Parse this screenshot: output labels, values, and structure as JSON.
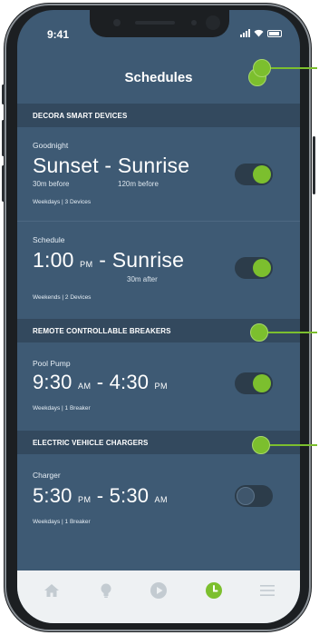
{
  "status_bar": {
    "time": "9:41"
  },
  "header": {
    "title": "Schedules"
  },
  "sections": [
    {
      "label": "DECORA SMART DEVICES"
    },
    {
      "label": "REMOTE CONTROLLABLE BREAKERS"
    },
    {
      "label": "ELECTRIC VEHICLE CHARGERS"
    }
  ],
  "schedules": [
    {
      "title": "Goodnight",
      "start": "Sunset",
      "start_ampm": "",
      "sep": " - ",
      "end": "Sunrise",
      "end_ampm": "",
      "start_offset": "30m before",
      "end_offset": "120m before",
      "meta": "Weekdays | 3 Devices",
      "enabled": true
    },
    {
      "title": "Schedule",
      "start": "1:00",
      "start_ampm": "PM",
      "sep": " - ",
      "end": "Sunrise",
      "end_ampm": "",
      "start_offset": "",
      "end_offset": "30m after",
      "meta": "Weekends | 2 Devices",
      "enabled": true
    },
    {
      "title": "Pool Pump",
      "start": "9:30",
      "start_ampm": "AM",
      "sep": " - ",
      "end": "4:30",
      "end_ampm": "PM",
      "start_offset": "",
      "end_offset": "",
      "meta": "Weekdays | 1 Breaker",
      "enabled": true
    },
    {
      "title": "Charger",
      "start": "5:30",
      "start_ampm": "PM",
      "sep": " - ",
      "end": "5:30",
      "end_ampm": "AM",
      "start_offset": "",
      "end_offset": "",
      "meta": "Weekdays | 1 Breaker",
      "enabled": false
    }
  ],
  "colors": {
    "accent": "#7cbf2e",
    "screen_bg": "#3e5a74",
    "section_bg": "#33495e",
    "navbar_bg": "#eef1f3",
    "nav_inactive": "#c3cbd1"
  },
  "nav": [
    {
      "icon": "home-icon",
      "active": false
    },
    {
      "icon": "lightbulb-icon",
      "active": false
    },
    {
      "icon": "play-icon",
      "active": false
    },
    {
      "icon": "clock-icon",
      "active": true
    },
    {
      "icon": "menu-icon",
      "active": false
    }
  ]
}
